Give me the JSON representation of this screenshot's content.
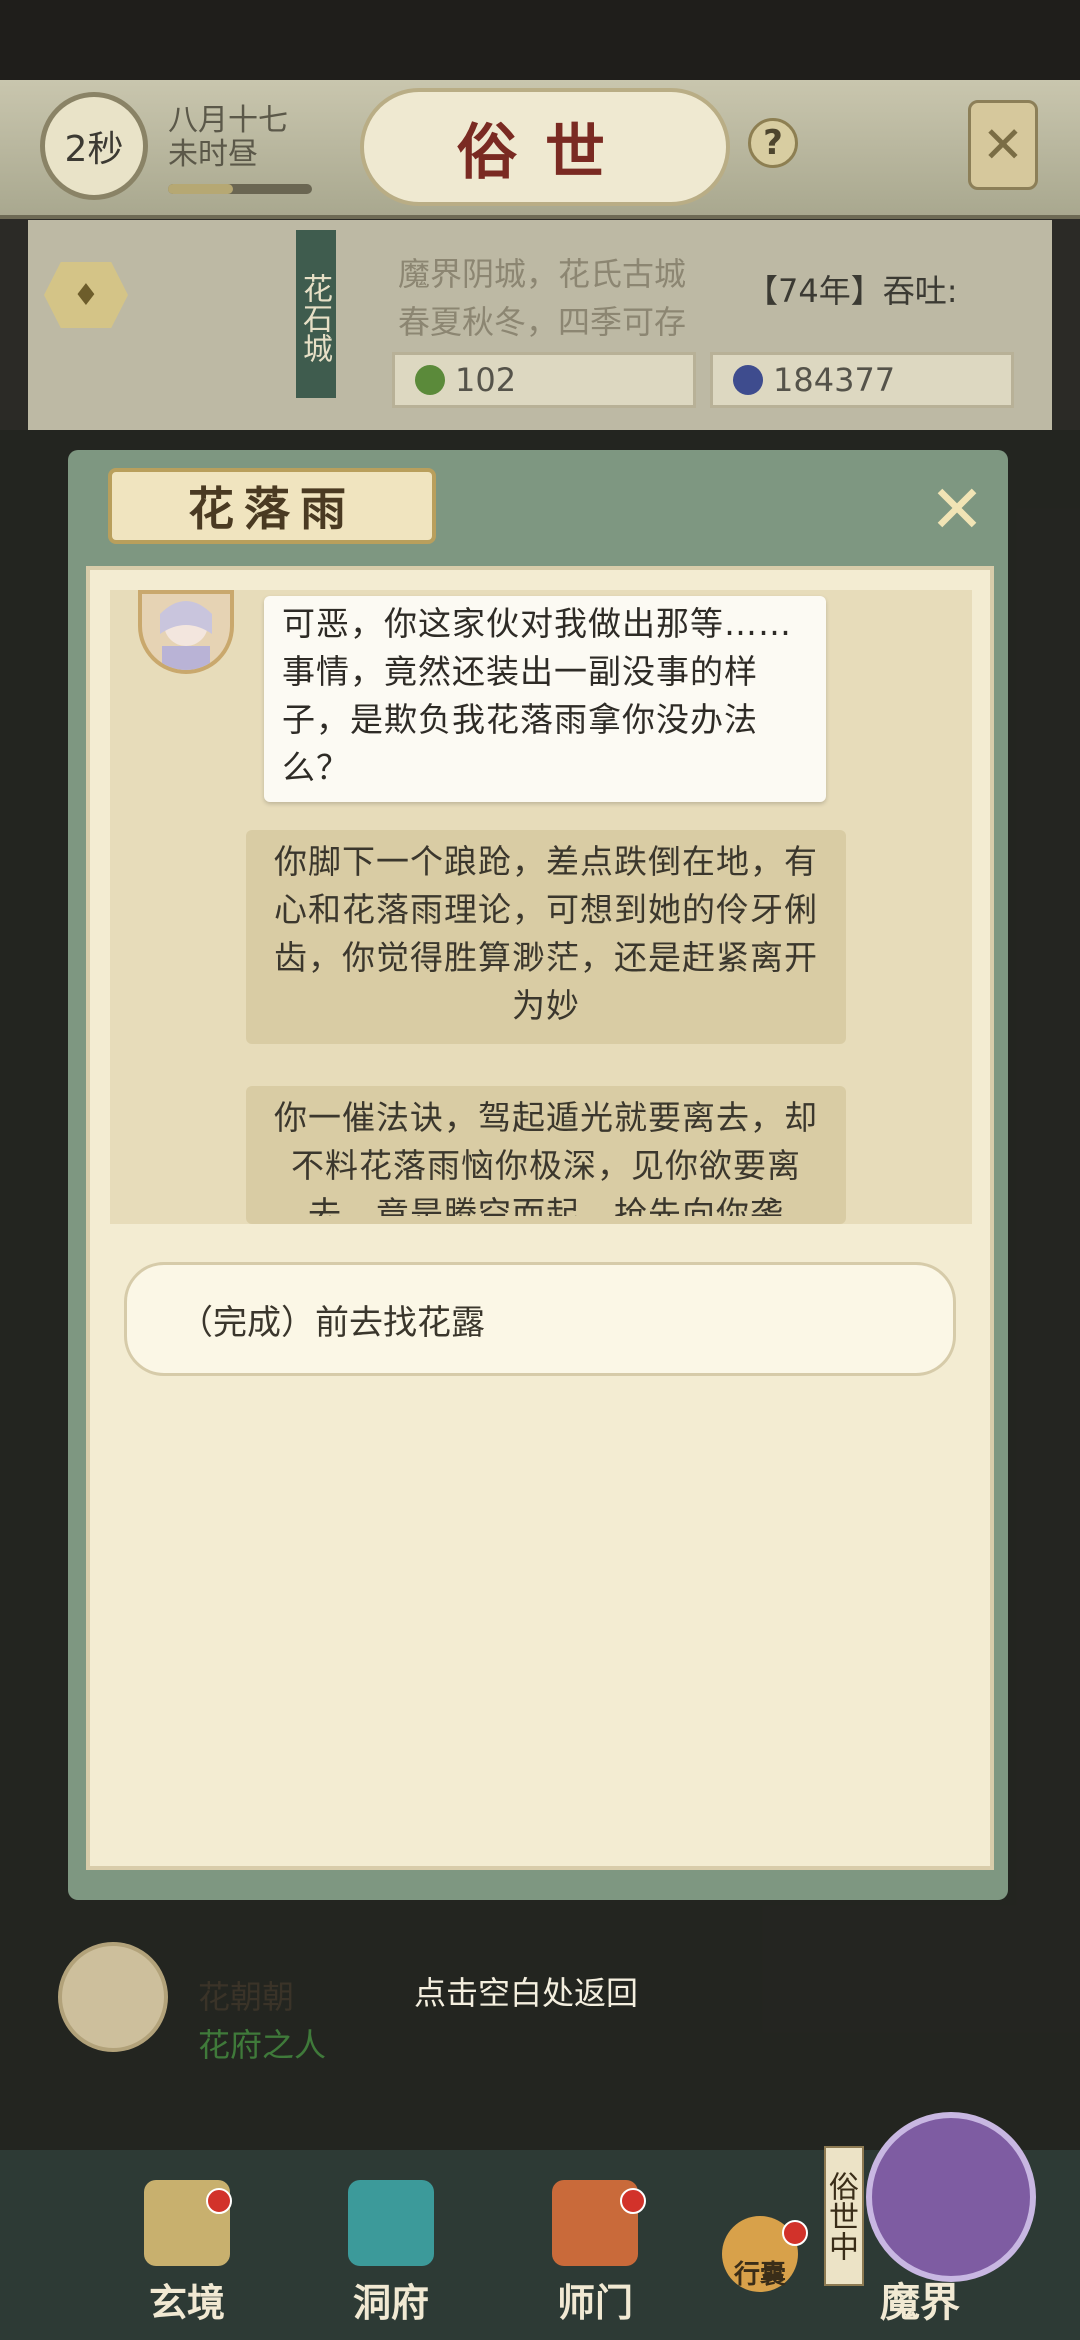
{
  "hud": {
    "timer": "2秒",
    "date_line1": "八月十七",
    "date_line2": "未时昼",
    "progress": 0.45,
    "title": "俗世",
    "help": "?"
  },
  "location": {
    "vertical_name": "花石城",
    "description_line1": "魔界阴城，花氏古城",
    "description_line2": "春夏秋冬，四季可存",
    "ticker": "【74年】吞吐:",
    "stat1": "102",
    "stat2": "184377"
  },
  "dialog": {
    "speaker": "花落雨",
    "speech": "可恶，你这家伙对我做出那等……事情，竟然还装出一副没事的样子，是欺负我花落雨拿你没办法么？",
    "narration1": "你脚下一个踉跄，差点跌倒在地，有心和花落雨理论，可想到她的伶牙俐齿，你觉得胜算渺茫，还是赶紧离开为妙",
    "narration2": "你一催法诀，驾起遁光就要离去，却不料花落雨恼你极深，见你欲要离去，竟是腾空而起，抢先向你袭",
    "option": "（完成）前去找花露"
  },
  "footer": {
    "npc_name": "花朝朝",
    "npc_role": "花府之人",
    "hint": "点击空白处返回"
  },
  "nav": {
    "items": [
      {
        "label": "玄境"
      },
      {
        "label": "洞府"
      },
      {
        "label": "师门"
      },
      {
        "label": "行囊"
      },
      {
        "label": "魔界"
      }
    ],
    "mojie_vertical": "俗世中"
  },
  "colors": {
    "accent": "#7a2a22",
    "frame": "#7e9781",
    "paper": "#f3ecd2",
    "badge": "#d2322a"
  }
}
